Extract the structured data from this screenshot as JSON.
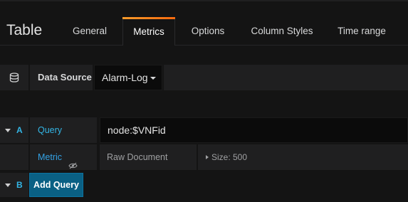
{
  "panel": {
    "title": "Table"
  },
  "tabs": [
    {
      "label": "General",
      "active": false
    },
    {
      "label": "Metrics",
      "active": true
    },
    {
      "label": "Options",
      "active": false
    },
    {
      "label": "Column Styles",
      "active": false
    },
    {
      "label": "Time range",
      "active": false
    }
  ],
  "datasource": {
    "icon": "database-icon",
    "label": "Data Source",
    "selected": "Alarm-Log"
  },
  "queries": [
    {
      "ref_id": "A",
      "query_label": "Query",
      "query_value": "node:$VNFid",
      "metric_label": "Metric",
      "metric_type": "Raw Document",
      "size_text": "Size: 500"
    }
  ],
  "add_query": {
    "ref_id": "B",
    "label": "Add Query"
  },
  "colors": {
    "accent": "#33b5e5",
    "primary_button": "#0a6084",
    "active_tab_gradient": [
      "#f99b2b",
      "#fb6a0d"
    ]
  }
}
